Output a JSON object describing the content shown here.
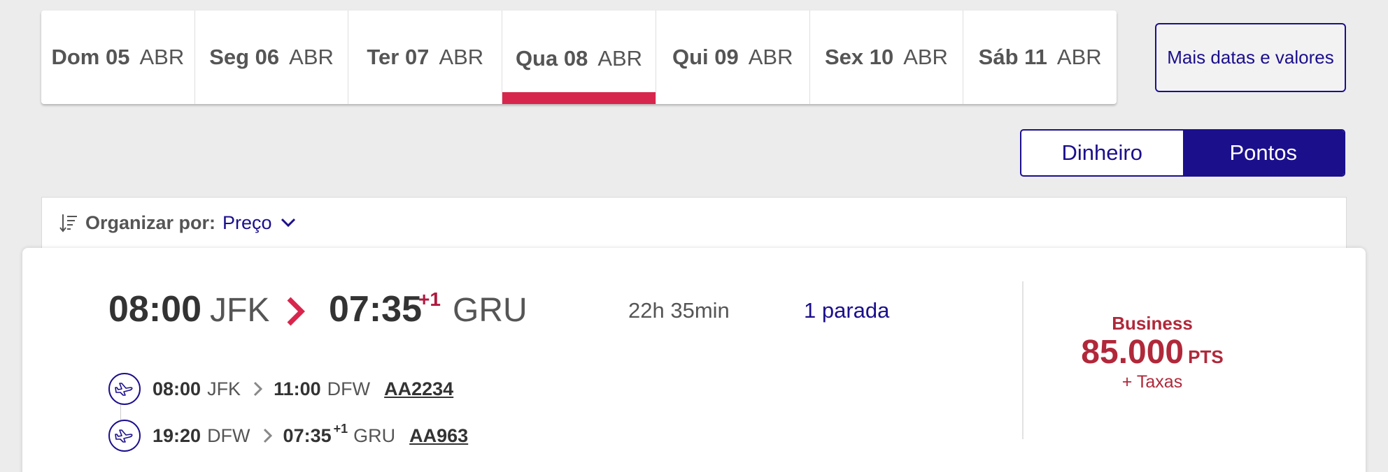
{
  "date_tabs": [
    {
      "day": "Dom 05",
      "month": "ABR"
    },
    {
      "day": "Seg 06",
      "month": "ABR"
    },
    {
      "day": "Ter 07",
      "month": "ABR"
    },
    {
      "day": "Qua 08",
      "month": "ABR"
    },
    {
      "day": "Qui 09",
      "month": "ABR"
    },
    {
      "day": "Sex 10",
      "month": "ABR"
    },
    {
      "day": "Sáb 11",
      "month": "ABR"
    }
  ],
  "selected_date_index": 3,
  "more_dates_label": "Mais datas e valores",
  "currency_toggle": {
    "money_label": "Dinheiro",
    "points_label": "Pontos",
    "active": "points"
  },
  "sort": {
    "label": "Organizar por:",
    "value": "Preço",
    "icon": "sort-icon"
  },
  "flight": {
    "departure_time": "08:00",
    "departure_code": "JFK",
    "arrival_time": "07:35",
    "arrival_day_offset": "+1",
    "arrival_code": "GRU",
    "duration": "22h 35min",
    "stops": "1 parada",
    "segments": [
      {
        "dep_time": "08:00",
        "dep_code": "JFK",
        "arr_time": "11:00",
        "arr_day_offset": "",
        "arr_code": "DFW",
        "flight_number": "AA2234"
      },
      {
        "dep_time": "19:20",
        "dep_code": "DFW",
        "arr_time": "07:35",
        "arr_day_offset": "+1",
        "arr_code": "GRU",
        "flight_number": "AA963"
      }
    ],
    "fare": {
      "cabin": "Business",
      "amount": "85.000",
      "unit": "PTS",
      "taxes": "+ Taxas"
    }
  },
  "colors": {
    "brand_navy": "#1b0f8c",
    "accent_red": "#d7264d",
    "price_red": "#b0283a"
  }
}
